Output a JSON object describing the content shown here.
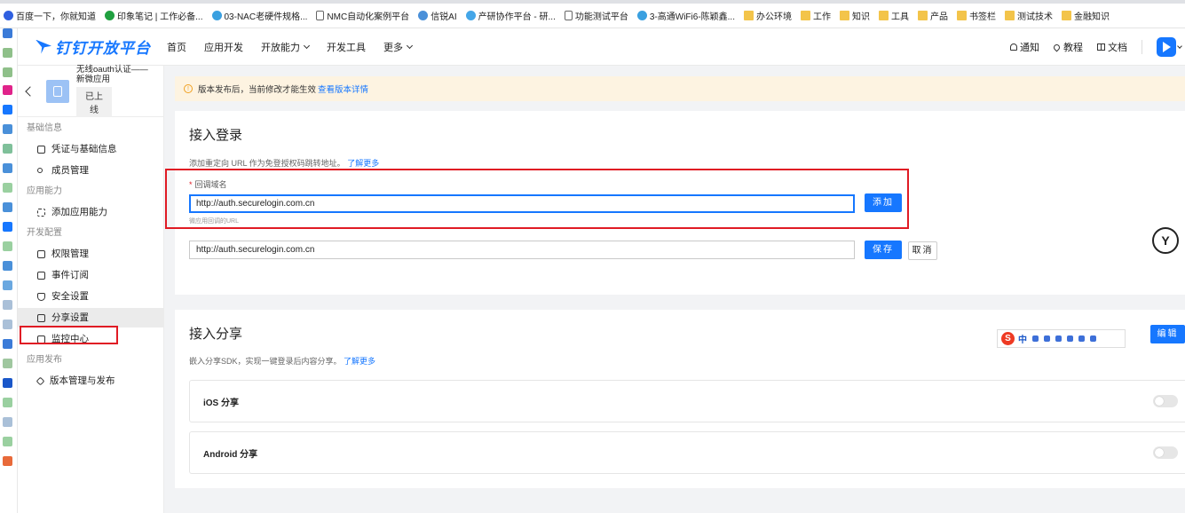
{
  "bookmarks": [
    {
      "label": "百度一下，你就知道",
      "icon": "baidu-icon",
      "color": "#3060e0"
    },
    {
      "label": "印象笔记 | 工作必备...",
      "icon": "evernote-icon",
      "color": "#20a040"
    },
    {
      "label": "03-NAC老硬件规格...",
      "icon": "doc-icon",
      "color": "#3aa0e0"
    },
    {
      "label": "NMC自动化案例平台",
      "icon": "page-icon",
      "color": "#666666"
    },
    {
      "label": "信锐AI",
      "icon": "sundray-icon",
      "color": "#4a90d9"
    },
    {
      "label": "产研协作平台 - 研...",
      "icon": "platform-icon",
      "color": "#44a6e8"
    },
    {
      "label": "功能测试平台",
      "icon": "page-icon",
      "color": "#666666"
    },
    {
      "label": "3-高通WiFi6-陈颖鑫...",
      "icon": "doc-icon",
      "color": "#3aa0e0"
    },
    {
      "label": "办公环境",
      "icon": "folder-icon",
      "color": "#f3c44a"
    },
    {
      "label": "工作",
      "icon": "folder-icon",
      "color": "#f3c44a"
    },
    {
      "label": "知识",
      "icon": "folder-icon",
      "color": "#f3c44a"
    },
    {
      "label": "工具",
      "icon": "folder-icon",
      "color": "#f3c44a"
    },
    {
      "label": "产品",
      "icon": "folder-icon",
      "color": "#f3c44a"
    },
    {
      "label": "书签栏",
      "icon": "folder-icon",
      "color": "#f3c44a"
    },
    {
      "label": "测试技术",
      "icon": "folder-icon",
      "color": "#f3c44a"
    },
    {
      "label": "金融知识",
      "icon": "folder-icon",
      "color": "#f3c44a"
    }
  ],
  "header": {
    "logo_text": "钉钉开放平台",
    "nav": [
      {
        "label": "首页",
        "dropdown": false
      },
      {
        "label": "应用开发",
        "dropdown": false
      },
      {
        "label": "开放能力",
        "dropdown": true
      },
      {
        "label": "开发工具",
        "dropdown": false
      },
      {
        "label": "更多",
        "dropdown": true
      }
    ],
    "notify_label": "通知",
    "tutorial_label": "教程",
    "docs_label": "文档",
    "accent_color": "#1677ff"
  },
  "sidebar": {
    "app_name": "无线oauth认证——新微应用",
    "app_status": "已上线",
    "groups": [
      {
        "title": "基础信息",
        "items": [
          {
            "label": "凭证与基础信息",
            "icon": "credential-icon",
            "active": false
          },
          {
            "label": "成员管理",
            "icon": "member-icon",
            "active": false
          }
        ]
      },
      {
        "title": "应用能力",
        "items": [
          {
            "label": "添加应用能力",
            "icon": "add-capability-icon",
            "active": false
          }
        ]
      },
      {
        "title": "开发配置",
        "items": [
          {
            "label": "权限管理",
            "icon": "permission-icon",
            "active": false
          },
          {
            "label": "事件订阅",
            "icon": "event-icon",
            "active": false
          },
          {
            "label": "安全设置",
            "icon": "shield-icon",
            "active": false
          },
          {
            "label": "分享设置",
            "icon": "share-icon",
            "active": true
          },
          {
            "label": "监控中心",
            "icon": "monitor-icon",
            "active": false
          }
        ]
      },
      {
        "title": "应用发布",
        "items": [
          {
            "label": "版本管理与发布",
            "icon": "version-icon",
            "active": false
          }
        ]
      }
    ]
  },
  "notice": {
    "text": "版本发布后，当前修改才能生效",
    "link": "查看版本详情"
  },
  "login": {
    "title": "接入登录",
    "desc": "添加重定向 URL 作为免登授权码跳转地址。",
    "desc_link": "了解更多",
    "field_label": "回调域名",
    "field_value": "http://auth.securelogin.com.cn",
    "field_hint": "微应用回调的URL",
    "add_button": "添加",
    "existing_value": "http://auth.securelogin.com.cn",
    "save_button": "保存",
    "cancel_button": "取消"
  },
  "share": {
    "title": "接入分享",
    "desc": "嵌入分享SDK，实现一键登录后内容分享。",
    "desc_link": "了解更多",
    "edit_button": "编辑",
    "rows": [
      {
        "label": "iOS 分享",
        "enabled": false
      },
      {
        "label": "Android 分享",
        "enabled": false
      }
    ]
  },
  "ime": {
    "logo": "S",
    "mode": "中"
  }
}
